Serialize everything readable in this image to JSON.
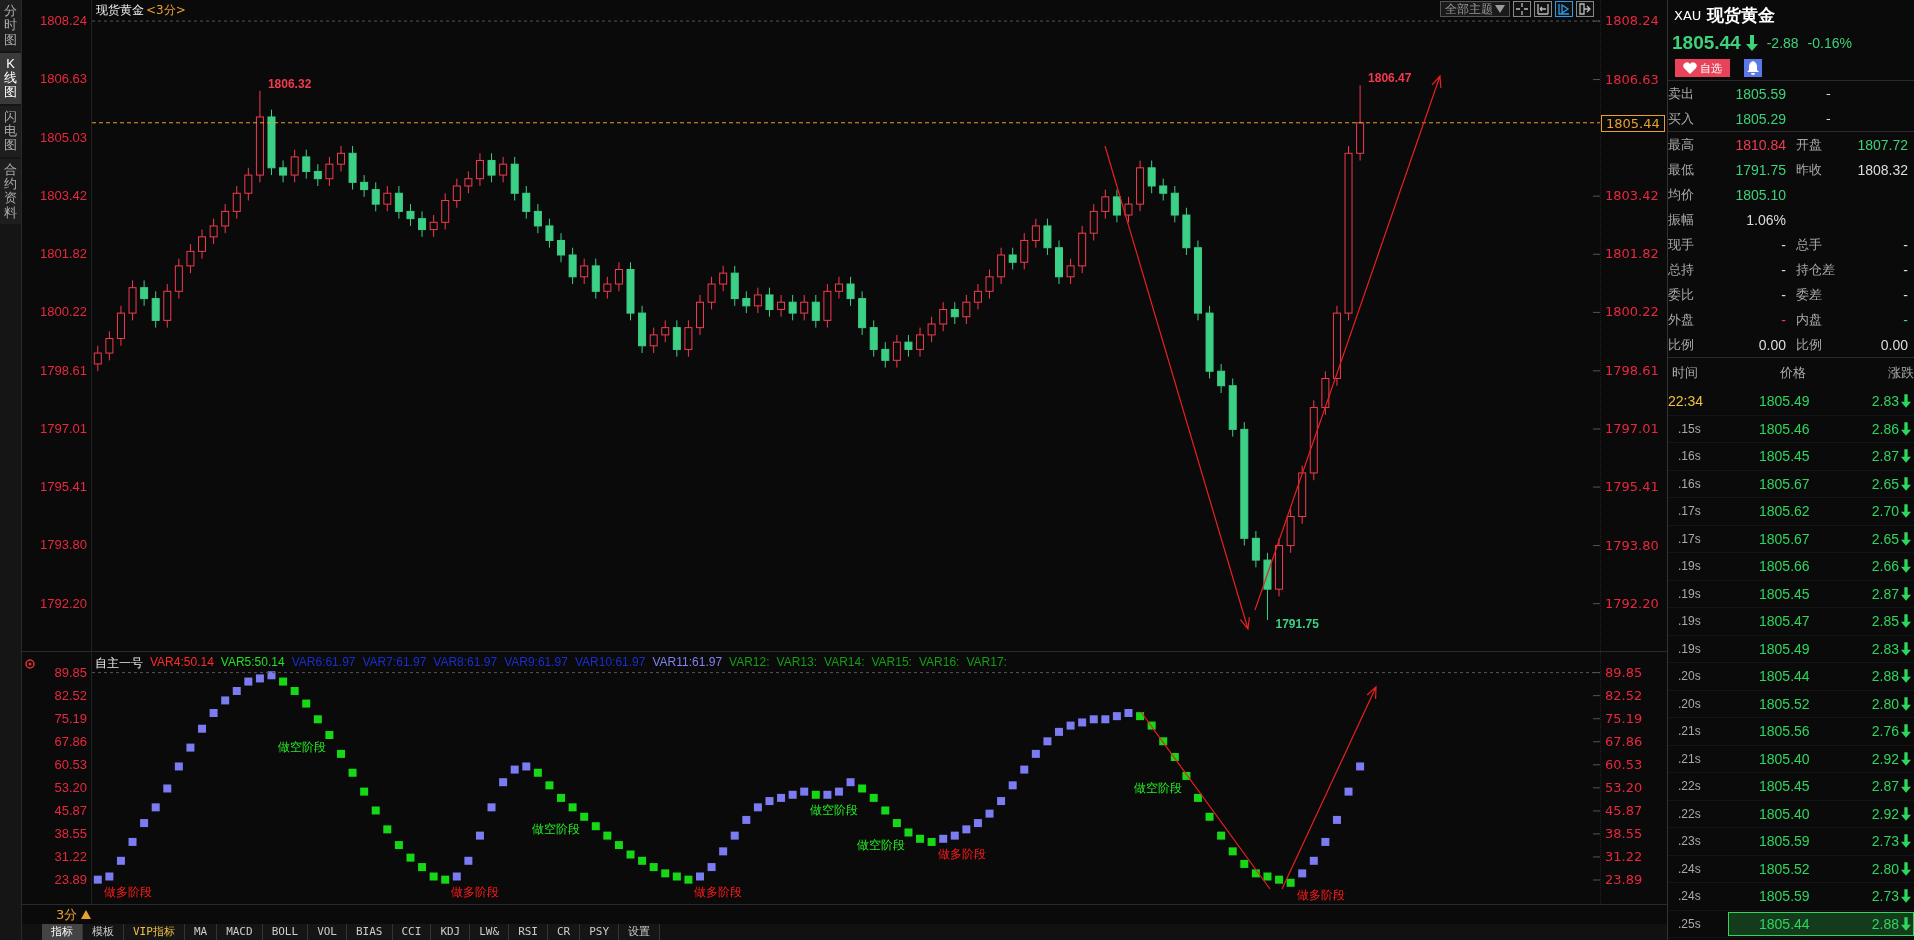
{
  "side_tabs": [
    {
      "label": "分时图",
      "selected": false
    },
    {
      "label": "K线图",
      "selected": true
    },
    {
      "label": "闪电图",
      "selected": false
    },
    {
      "label": "合约资料",
      "selected": false
    }
  ],
  "main_chart": {
    "title": "现货黄金",
    "period": "<3分>",
    "toolbar": {
      "dropdown": "全部主题",
      "buttons": [
        {
          "kind": "cross",
          "selected": false
        },
        {
          "kind": "bracket",
          "selected": false
        },
        {
          "kind": "play",
          "selected": true
        },
        {
          "kind": "exit",
          "selected": false
        }
      ]
    },
    "left_axis": [
      "1808.24",
      "1806.63",
      "1805.03",
      "1803.42",
      "1801.82",
      "1800.22",
      "1798.61",
      "1797.01",
      "1795.41",
      "1793.80",
      "1792.20"
    ],
    "chart_data": {
      "type": "candlestick",
      "ylim": [
        1790.87,
        1808.82
      ],
      "ohlc": [
        [
          1798.8,
          1799.3,
          1798.6,
          1799.1
        ],
        [
          1799.1,
          1799.7,
          1798.9,
          1799.5
        ],
        [
          1799.5,
          1800.4,
          1799.3,
          1800.2
        ],
        [
          1800.2,
          1801.1,
          1800.0,
          1800.9
        ],
        [
          1800.9,
          1801.1,
          1800.4,
          1800.6
        ],
        [
          1800.6,
          1800.8,
          1799.8,
          1800.0
        ],
        [
          1800.0,
          1801.0,
          1799.8,
          1800.8
        ],
        [
          1800.8,
          1801.7,
          1800.6,
          1801.5
        ],
        [
          1801.5,
          1802.1,
          1801.3,
          1801.9
        ],
        [
          1801.9,
          1802.5,
          1801.7,
          1802.3
        ],
        [
          1802.3,
          1802.8,
          1802.1,
          1802.6
        ],
        [
          1802.6,
          1803.2,
          1802.4,
          1803.0
        ],
        [
          1803.0,
          1803.7,
          1802.8,
          1803.5
        ],
        [
          1803.5,
          1804.2,
          1803.3,
          1804.0
        ],
        [
          1804.0,
          1806.32,
          1803.8,
          1805.6
        ],
        [
          1805.6,
          1805.8,
          1804.0,
          1804.2
        ],
        [
          1804.2,
          1804.4,
          1803.8,
          1804.0
        ],
        [
          1804.0,
          1804.7,
          1803.8,
          1804.5
        ],
        [
          1804.5,
          1804.7,
          1803.9,
          1804.1
        ],
        [
          1804.1,
          1804.3,
          1803.7,
          1803.9
        ],
        [
          1803.9,
          1804.5,
          1803.7,
          1804.3
        ],
        [
          1804.3,
          1804.8,
          1804.1,
          1804.6
        ],
        [
          1804.6,
          1804.8,
          1803.6,
          1803.8
        ],
        [
          1803.8,
          1804.0,
          1803.4,
          1803.6
        ],
        [
          1803.6,
          1803.8,
          1803.0,
          1803.2
        ],
        [
          1803.2,
          1803.7,
          1803.0,
          1803.5
        ],
        [
          1803.5,
          1803.7,
          1802.8,
          1803.0
        ],
        [
          1803.0,
          1803.2,
          1802.6,
          1802.8
        ],
        [
          1802.8,
          1803.0,
          1802.3,
          1802.5
        ],
        [
          1802.5,
          1802.9,
          1802.3,
          1802.7
        ],
        [
          1802.7,
          1803.5,
          1802.5,
          1803.3
        ],
        [
          1803.3,
          1803.9,
          1803.1,
          1803.7
        ],
        [
          1803.7,
          1804.1,
          1803.5,
          1803.9
        ],
        [
          1803.9,
          1804.6,
          1803.7,
          1804.4
        ],
        [
          1804.4,
          1804.6,
          1803.8,
          1804.0
        ],
        [
          1804.0,
          1804.5,
          1803.8,
          1804.3
        ],
        [
          1804.3,
          1804.5,
          1803.3,
          1803.5
        ],
        [
          1803.5,
          1803.7,
          1802.8,
          1803.0
        ],
        [
          1803.0,
          1803.2,
          1802.4,
          1802.6
        ],
        [
          1802.6,
          1802.8,
          1802.0,
          1802.2
        ],
        [
          1802.2,
          1802.4,
          1801.6,
          1801.8
        ],
        [
          1801.8,
          1802.0,
          1801.0,
          1801.2
        ],
        [
          1801.2,
          1801.7,
          1801.0,
          1801.5
        ],
        [
          1801.5,
          1801.7,
          1800.6,
          1800.8
        ],
        [
          1800.8,
          1801.2,
          1800.6,
          1801.0
        ],
        [
          1801.0,
          1801.6,
          1800.8,
          1801.4
        ],
        [
          1801.4,
          1801.6,
          1800.0,
          1800.2
        ],
        [
          1800.2,
          1800.4,
          1799.1,
          1799.3
        ],
        [
          1799.3,
          1799.8,
          1799.1,
          1799.6
        ],
        [
          1799.6,
          1800.0,
          1799.4,
          1799.8
        ],
        [
          1799.8,
          1800.0,
          1799.0,
          1799.2
        ],
        [
          1799.2,
          1800.0,
          1799.0,
          1799.8
        ],
        [
          1799.8,
          1800.7,
          1799.6,
          1800.5
        ],
        [
          1800.5,
          1801.2,
          1800.3,
          1801.0
        ],
        [
          1801.0,
          1801.5,
          1800.8,
          1801.3
        ],
        [
          1801.3,
          1801.5,
          1800.4,
          1800.6
        ],
        [
          1800.6,
          1800.8,
          1800.2,
          1800.4
        ],
        [
          1800.4,
          1800.9,
          1800.2,
          1800.7
        ],
        [
          1800.7,
          1800.9,
          1800.1,
          1800.3
        ],
        [
          1800.3,
          1800.7,
          1800.1,
          1800.5
        ],
        [
          1800.5,
          1800.7,
          1800.0,
          1800.2
        ],
        [
          1800.2,
          1800.7,
          1800.0,
          1800.5
        ],
        [
          1800.5,
          1800.7,
          1799.8,
          1800.0
        ],
        [
          1800.0,
          1801.0,
          1799.8,
          1800.8
        ],
        [
          1800.8,
          1801.2,
          1800.6,
          1801.0
        ],
        [
          1801.0,
          1801.2,
          1800.4,
          1800.6
        ],
        [
          1800.6,
          1800.8,
          1799.6,
          1799.8
        ],
        [
          1799.8,
          1800.0,
          1799.0,
          1799.2
        ],
        [
          1799.2,
          1799.4,
          1798.7,
          1798.9
        ],
        [
          1798.9,
          1799.6,
          1798.7,
          1799.4
        ],
        [
          1799.4,
          1799.6,
          1799.0,
          1799.2
        ],
        [
          1799.2,
          1799.8,
          1799.0,
          1799.6
        ],
        [
          1799.6,
          1800.1,
          1799.4,
          1799.9
        ],
        [
          1799.9,
          1800.5,
          1799.7,
          1800.3
        ],
        [
          1800.3,
          1800.5,
          1799.9,
          1800.1
        ],
        [
          1800.1,
          1800.7,
          1799.9,
          1800.5
        ],
        [
          1800.5,
          1801.0,
          1800.3,
          1800.8
        ],
        [
          1800.8,
          1801.4,
          1800.6,
          1801.2
        ],
        [
          1801.2,
          1802.0,
          1801.0,
          1801.8
        ],
        [
          1801.8,
          1802.0,
          1801.4,
          1801.6
        ],
        [
          1801.6,
          1802.4,
          1801.4,
          1802.2
        ],
        [
          1802.2,
          1802.8,
          1802.0,
          1802.6
        ],
        [
          1802.6,
          1802.8,
          1801.8,
          1802.0
        ],
        [
          1802.0,
          1802.2,
          1801.0,
          1801.2
        ],
        [
          1801.2,
          1801.7,
          1801.0,
          1801.5
        ],
        [
          1801.5,
          1802.6,
          1801.3,
          1802.4
        ],
        [
          1802.4,
          1803.2,
          1802.2,
          1803.0
        ],
        [
          1803.0,
          1803.6,
          1802.8,
          1803.4
        ],
        [
          1803.4,
          1803.6,
          1802.7,
          1802.9
        ],
        [
          1802.9,
          1803.4,
          1802.7,
          1803.2
        ],
        [
          1803.2,
          1804.4,
          1803.0,
          1804.2
        ],
        [
          1804.2,
          1804.4,
          1803.5,
          1803.7
        ],
        [
          1803.7,
          1803.9,
          1803.3,
          1803.5
        ],
        [
          1803.5,
          1803.7,
          1802.7,
          1802.9
        ],
        [
          1802.9,
          1803.1,
          1801.8,
          1802.0
        ],
        [
          1802.0,
          1802.2,
          1800.0,
          1800.2
        ],
        [
          1800.2,
          1800.4,
          1798.4,
          1798.6
        ],
        [
          1798.6,
          1798.8,
          1798.0,
          1798.2
        ],
        [
          1798.2,
          1798.4,
          1796.8,
          1797.0
        ],
        [
          1797.0,
          1797.2,
          1793.8,
          1794.0
        ],
        [
          1794.0,
          1794.2,
          1793.2,
          1793.4
        ],
        [
          1793.4,
          1793.6,
          1791.75,
          1792.6
        ],
        [
          1792.6,
          1794.0,
          1792.4,
          1793.8
        ],
        [
          1793.8,
          1794.8,
          1793.6,
          1794.6
        ],
        [
          1794.6,
          1796.0,
          1794.4,
          1795.8
        ],
        [
          1795.8,
          1797.8,
          1795.6,
          1797.6
        ],
        [
          1797.6,
          1798.6,
          1797.4,
          1798.4
        ],
        [
          1798.4,
          1800.4,
          1798.2,
          1800.2
        ],
        [
          1800.2,
          1804.8,
          1800.0,
          1804.6
        ],
        [
          1804.6,
          1806.47,
          1804.4,
          1805.44
        ],
        null,
        null,
        null,
        null,
        null,
        null,
        null,
        null,
        null,
        null,
        null,
        null,
        null,
        null,
        null,
        null,
        null,
        null,
        null,
        null,
        null,
        null,
        null,
        null,
        null,
        null
      ],
      "yticks": [
        1808.24,
        1806.63,
        1803.42,
        1801.82,
        1800.22,
        1798.61,
        1797.01,
        1795.41,
        {
          "value": 1793.8,
          "label": "1793.80"
        },
        {
          "value": 1792.2,
          "label": "1792.20"
        }
      ],
      "annotations": [
        "1806.32",
        "1806.47",
        "1791.75"
      ]
    },
    "price_tag": "1805.44"
  },
  "indicator": {
    "name": "自主一号",
    "vars": [
      {
        "text": "VAR4:50.14",
        "color": "#ff2a2a"
      },
      {
        "text": "VAR5:50.14",
        "color": "#22e022"
      },
      {
        "text": "VAR6:61.97",
        "color": "#1a2ed0"
      },
      {
        "text": "VAR7:61.97",
        "color": "#1a2ed0"
      },
      {
        "text": "VAR8:61.97",
        "color": "#1a2ed0"
      },
      {
        "text": "VAR9:61.97",
        "color": "#1a2ed0"
      },
      {
        "text": "VAR10:61.97",
        "color": "#1a2ed0"
      },
      {
        "text": "VAR11:61.97",
        "color": "#8080f0"
      },
      {
        "text": "VAR12:",
        "color": "#12a012"
      },
      {
        "text": "VAR13:",
        "color": "#12a012"
      },
      {
        "text": "VAR14:",
        "color": "#12a012"
      },
      {
        "text": "VAR15:",
        "color": "#12a012"
      },
      {
        "text": "VAR16:",
        "color": "#12a012"
      },
      {
        "text": "VAR17:",
        "color": "#12a012"
      }
    ],
    "left_axis": [
      "89.85",
      "82.52",
      "75.19",
      "67.86",
      "60.53",
      "53.20",
      "45.87",
      "38.55",
      "31.22",
      "23.89"
    ],
    "chart_data": {
      "type": "scatter",
      "ylim": [
        16.26,
        96.4
      ],
      "values": [
        24,
        25,
        30,
        36,
        42,
        47,
        53,
        60,
        66,
        72,
        77,
        81,
        84,
        87,
        88,
        89,
        87,
        84,
        80,
        75,
        70,
        64,
        58,
        52,
        46,
        40,
        35,
        31,
        28,
        25,
        24,
        25,
        30,
        38,
        47,
        55,
        59,
        60,
        58,
        54,
        50,
        47,
        44,
        41,
        38,
        35,
        32,
        30,
        28,
        26,
        25,
        24,
        25,
        28,
        33,
        38,
        43,
        47,
        49,
        50,
        51,
        52,
        51,
        51,
        52,
        55,
        53,
        50,
        46,
        42,
        39,
        37,
        36,
        37,
        38,
        40,
        42,
        45,
        49,
        54,
        59,
        64,
        68,
        71,
        73,
        74,
        75,
        75,
        76,
        77,
        76,
        73,
        68,
        63,
        57,
        50,
        44,
        38,
        33,
        29,
        26,
        25,
        24,
        23,
        26,
        30,
        36,
        43,
        52,
        60,
        null,
        null,
        null,
        null,
        null,
        null,
        null,
        null,
        null,
        null,
        null,
        null,
        null,
        null,
        null,
        null,
        null,
        null,
        null,
        null,
        null,
        null,
        null,
        null,
        null,
        null
      ],
      "yticks": [
        89.85,
        82.52,
        75.19,
        67.86,
        60.53,
        {
          "value": 53.2,
          "label": "53.20"
        },
        45.87,
        38.55,
        31.22,
        23.89
      ],
      "annotations": [
        "做多阶段",
        "做空阶段",
        "做多阶段",
        "做空阶段",
        "做多阶段",
        "做空阶段",
        "做空阶段",
        "做多阶段",
        "做空阶段",
        "做多阶段"
      ]
    }
  },
  "period_selector": {
    "label": "3分"
  },
  "bottom_tabs": [
    {
      "label": "指标",
      "kind": "plain",
      "selected": true
    },
    {
      "label": "模板",
      "kind": "plain",
      "selected": false
    },
    {
      "label": "VIP指标",
      "kind": "vip",
      "selected": false
    },
    {
      "label": "MA",
      "kind": "plain",
      "selected": false
    },
    {
      "label": "MACD",
      "kind": "plain",
      "selected": false
    },
    {
      "label": "BOLL",
      "kind": "plain",
      "selected": false
    },
    {
      "label": "VOL",
      "kind": "plain",
      "selected": false
    },
    {
      "label": "BIAS",
      "kind": "plain",
      "selected": false
    },
    {
      "label": "CCI",
      "kind": "plain",
      "selected": false
    },
    {
      "label": "KDJ",
      "kind": "plain",
      "selected": false
    },
    {
      "label": "LW&",
      "kind": "plain",
      "selected": false
    },
    {
      "label": "RSI",
      "kind": "plain",
      "selected": false
    },
    {
      "label": "CR",
      "kind": "plain",
      "selected": false
    },
    {
      "label": "PSY",
      "kind": "plain",
      "selected": false
    },
    {
      "label": "设置",
      "kind": "plain",
      "selected": false
    }
  ],
  "quote_panel": {
    "code": "XAU",
    "name": "现货黄金",
    "price": "1805.44",
    "falling": true,
    "change": "-2.88",
    "change_pct": "-0.16%",
    "watch_button": "自选",
    "quotes": [
      {
        "label": "卖出",
        "value": "1805.59",
        "color": "#3ed17a",
        "volume": "-"
      },
      {
        "label": "买入",
        "value": "1805.29",
        "color": "#3ed17a",
        "volume": "-"
      }
    ],
    "stats": [
      {
        "label": "最高",
        "value": "1810.84",
        "color": "#f03c52",
        "pair": {
          "label": "开盘",
          "value": "1807.72",
          "color": "#3ed17a"
        }
      },
      {
        "label": "最低",
        "value": "1791.75",
        "color": "#3ed17a",
        "pair": {
          "label": "昨收",
          "value": "1808.32",
          "color": "#dddddd"
        }
      },
      {
        "label": "均价",
        "value": "1805.10",
        "color": "#3ed17a"
      },
      {
        "label": "振幅",
        "value": "1.06%",
        "color": "#dddddd"
      },
      {
        "label": "现手",
        "value": "-",
        "color": "#dddddd",
        "pair": {
          "label": "总手",
          "value": "-",
          "color": "#dddddd"
        }
      },
      {
        "label": "总持",
        "value": "-",
        "color": "#dddddd",
        "pair": {
          "label": "持仓差",
          "value": "-",
          "color": "#dddddd"
        }
      },
      {
        "label": "委比",
        "value": "-",
        "color": "#dddddd",
        "pair": {
          "label": "委差",
          "value": "-",
          "color": "#dddddd"
        }
      },
      {
        "label": "外盘",
        "value": "-",
        "color": "#f03c52",
        "pair": {
          "label": "内盘",
          "value": "-",
          "color": "#3ed17a"
        }
      },
      {
        "label": "比例",
        "value": "0.00",
        "color": "#dddddd",
        "pair": {
          "label": "比例",
          "value": "0.00",
          "color": "#dddddd"
        }
      }
    ],
    "tick_columns": [
      "时间",
      "价格",
      "涨跌"
    ],
    "ticks": [
      {
        "kind": "minute",
        "time": "22:34",
        "price": "1805.49",
        "change": "2.83",
        "falling": true,
        "highlighted": false
      },
      {
        "kind": "second",
        "time": ".15s",
        "price": "1805.46",
        "change": "2.86",
        "falling": true,
        "highlighted": false
      },
      {
        "kind": "second",
        "time": ".16s",
        "price": "1805.45",
        "change": "2.87",
        "falling": true,
        "highlighted": false
      },
      {
        "kind": "second",
        "time": ".16s",
        "price": "1805.67",
        "change": "2.65",
        "falling": true,
        "highlighted": false
      },
      {
        "kind": "second",
        "time": ".17s",
        "price": "1805.62",
        "change": "2.70",
        "falling": true,
        "highlighted": false
      },
      {
        "kind": "second",
        "time": ".17s",
        "price": "1805.67",
        "change": "2.65",
        "falling": true,
        "highlighted": false
      },
      {
        "kind": "second",
        "time": ".19s",
        "price": "1805.66",
        "change": "2.66",
        "falling": true,
        "highlighted": false
      },
      {
        "kind": "second",
        "time": ".19s",
        "price": "1805.45",
        "change": "2.87",
        "falling": true,
        "highlighted": false
      },
      {
        "kind": "second",
        "time": ".19s",
        "price": "1805.47",
        "change": "2.85",
        "falling": true,
        "highlighted": false
      },
      {
        "kind": "second",
        "time": ".19s",
        "price": "1805.49",
        "change": "2.83",
        "falling": true,
        "highlighted": false
      },
      {
        "kind": "second",
        "time": ".20s",
        "price": "1805.44",
        "change": "2.88",
        "falling": true,
        "highlighted": false
      },
      {
        "kind": "second",
        "time": ".20s",
        "price": "1805.52",
        "change": "2.80",
        "falling": true,
        "highlighted": false
      },
      {
        "kind": "second",
        "time": ".21s",
        "price": "1805.56",
        "change": "2.76",
        "falling": true,
        "highlighted": false
      },
      {
        "kind": "second",
        "time": ".21s",
        "price": "1805.40",
        "change": "2.92",
        "falling": true,
        "highlighted": false
      },
      {
        "kind": "second",
        "time": ".22s",
        "price": "1805.45",
        "change": "2.87",
        "falling": true,
        "highlighted": false
      },
      {
        "kind": "second",
        "time": ".22s",
        "price": "1805.40",
        "change": "2.92",
        "falling": true,
        "highlighted": false
      },
      {
        "kind": "second",
        "time": ".23s",
        "price": "1805.59",
        "change": "2.73",
        "falling": true,
        "highlighted": false
      },
      {
        "kind": "second",
        "time": ".24s",
        "price": "1805.52",
        "change": "2.80",
        "falling": true,
        "highlighted": false
      },
      {
        "kind": "second",
        "time": ".24s",
        "price": "1805.59",
        "change": "2.73",
        "falling": true,
        "highlighted": false
      },
      {
        "kind": "second",
        "time": ".25s",
        "price": "1805.44",
        "change": "2.88",
        "falling": true,
        "highlighted": true
      }
    ]
  }
}
